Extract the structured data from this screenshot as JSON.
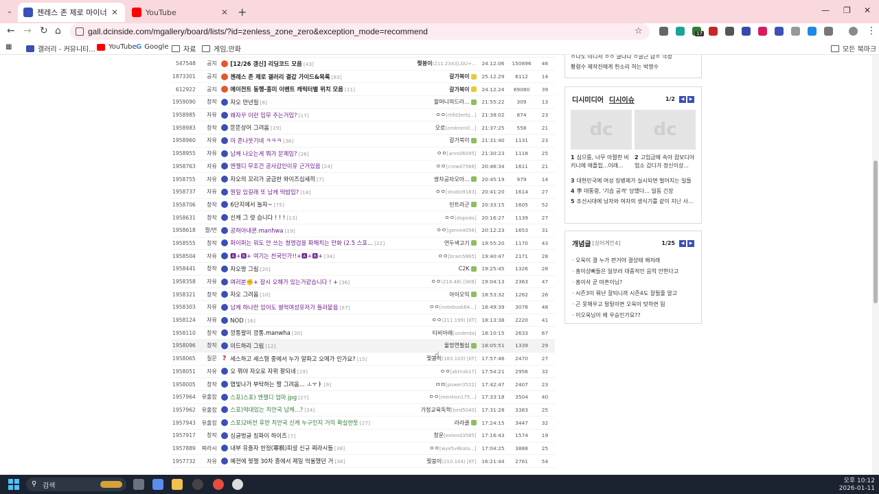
{
  "browser": {
    "tabs": [
      {
        "title": "젠레스 존 제로 마이너 갤러리",
        "active": true
      },
      {
        "title": "YouTube",
        "active": false
      }
    ],
    "url": "gall.dcinside.com/mgallery/board/lists/?id=zenless_zone_zero&exception_mode=recommend",
    "bookmarks": [
      "갤러리 - 커뮤니티...",
      "YouTube",
      "Google",
      "자료",
      "게임,만화"
    ],
    "all_bookmarks": "모든 북마크",
    "ext_badge": "17"
  },
  "notices": [
    {
      "num": "547548",
      "head": "공지",
      "title": "[12/26 갱신] 리딩코드 모음",
      "count": "[43]",
      "writer": "찢붕이",
      "ip": "(211.234)",
      "extra": "[LGU+...",
      "date": "24.12.06",
      "views": "150896",
      "rec": "46"
    },
    {
      "num": "1873301",
      "head": "공지",
      "title": "젠레스 존 제로 갤러리 결갑 가이드&목록",
      "count": "[83]",
      "writer": "갈가북이",
      "ip": "",
      "extra": "",
      "date": "25.12.29",
      "views": "6112",
      "rec": "14"
    },
    {
      "num": "612922",
      "head": "공지",
      "title": "에이전트 동행-흥미 이벤트 캐릭터별 위치 모음",
      "count": "[11]",
      "writer": "갈가북이",
      "ip": "",
      "extra": "",
      "date": "24.12.24",
      "views": "69080",
      "rec": "39"
    }
  ],
  "posts": [
    {
      "num": "1959090",
      "head": "창작",
      "icon": "pic",
      "title": "자오 만년필",
      "count": "[6]",
      "writer": "할머니의드라...",
      "ip": "",
      "date": "21:55:22",
      "views": "309",
      "rec": "13"
    },
    {
      "num": "1958985",
      "head": "자유",
      "icon": "recom",
      "title": "왜자꾸 이런 임무 주는거임?",
      "count": "[17]",
      "purple": true,
      "writer": "ㅇㅇ",
      "ip": "[rtifd3erbj...]",
      "date": "21:38:02",
      "views": "874",
      "rec": "23"
    },
    {
      "num": "1958983",
      "head": "창작",
      "icon": "pic",
      "title": "뚠뚠상어 그려옴",
      "count": "[19]",
      "writer": "오로",
      "ip": "[orokroni0...]",
      "date": "21:37:25",
      "views": "558",
      "rec": "21"
    },
    {
      "num": "1958960",
      "head": "자유",
      "icon": "recom",
      "title": "아 존나웃기네 ㅋㅋㅋ",
      "count": "[38]",
      "purple": true,
      "writer": "갈가북이",
      "ip": "",
      "date": "21:31:40",
      "views": "1131",
      "rec": "23"
    },
    {
      "num": "1958955",
      "head": "자유",
      "icon": "recom",
      "title": "남캐 나오는게 뭐가 문제임?",
      "count": "[26]",
      "purple": true,
      "writer": "ㅇㅇ",
      "ip": "[anroll6095]",
      "date": "21:30:23",
      "views": "1118",
      "rec": "25"
    },
    {
      "num": "1958763",
      "head": "자유",
      "icon": "recom",
      "title": "엔젤디 무조건 공사갑인이유 근거있음",
      "count": "[24]",
      "purple": true,
      "writer": "ㅇㅇ",
      "ip": "[crowd7566]",
      "date": "20:46:34",
      "views": "1611",
      "rec": "21"
    },
    {
      "num": "1958755",
      "head": "자유",
      "icon": "recom",
      "title": "자오의 꼬리가 궁금한 와이즈십새끼",
      "count": "[7]",
      "writer": "쌍차공자오아...",
      "ip": "",
      "date": "20:45:19",
      "views": "979",
      "rec": "14"
    },
    {
      "num": "1958737",
      "head": "자유",
      "icon": "recom",
      "title": "뭔일 있길래 또 남캐 떡밥임?",
      "count": "[18]",
      "purple": true,
      "writer": "ㅇㅇ",
      "ip": "[studio9183]",
      "date": "20:41:20",
      "views": "1614",
      "rec": "27"
    },
    {
      "num": "1958706",
      "head": "창작",
      "icon": "pic",
      "title": "6단지에서 놀자~",
      "count": "[75]",
      "writer": "민트라군",
      "ip": "",
      "date": "20:33:15",
      "views": "1605",
      "rec": "52"
    },
    {
      "num": "1958631",
      "head": "창작",
      "icon": "pic",
      "title": "신캐 그 렷 습니다 ! ! !",
      "count": "[13]",
      "writer": "ㅇㅇ",
      "ip": "[dopodo]",
      "date": "20:16:27",
      "views": "1139",
      "rec": "27"
    },
    {
      "num": "1958618",
      "head": "짤/번",
      "icon": "recom",
      "title": "공허아내쿤.manhwa",
      "count": "[19]",
      "purple": true,
      "writer": "ㅇㅇ",
      "ip": "[genre4056]",
      "date": "20:12:23",
      "views": "1653",
      "rec": "31"
    },
    {
      "num": "1958555",
      "head": "창작",
      "icon": "pic",
      "title": "파이퍼는 워도 안 쓰는 청명검을 파헤치는 만화 (2.5 스포...",
      "count": "[22]",
      "purple": true,
      "writer": "연두색고기",
      "ip": "",
      "date": "19:55:20",
      "views": "1170",
      "rec": "43"
    },
    {
      "num": "1958504",
      "head": "자유",
      "icon": "recom",
      "title": "🅰+🅱+ 여기는 천국인가!!+🅰+🅱+",
      "count": "[34]",
      "purple": true,
      "writer": "ㅇㅇ",
      "ip": "[brain5865]",
      "date": "19:40:47",
      "views": "2171",
      "rec": "28"
    },
    {
      "num": "1958441",
      "head": "창작",
      "icon": "pic",
      "title": "자오짱 그림",
      "count": "[20]",
      "writer": "C2K",
      "ip": "",
      "date": "19:25:45",
      "views": "1326",
      "rec": "28"
    },
    {
      "num": "1958358",
      "head": "자유",
      "icon": "recom",
      "title": "여러분✊+ 잠시 오해가 있는거같습니다 ! +",
      "count": "[36]",
      "purple": true,
      "writer": "ㅇㅇ",
      "ip": "(218.48) [SKB]",
      "date": "19:04:13",
      "views": "2363",
      "rec": "47"
    },
    {
      "num": "1958321",
      "head": "창작",
      "icon": "pic",
      "title": "자오 그려옴",
      "count": "[10]",
      "writer": "아이오익",
      "ip": "",
      "date": "18:53:32",
      "views": "1262",
      "rec": "26"
    },
    {
      "num": "1958303",
      "head": "자유",
      "icon": "recom",
      "title": "남캐 하나만 있어도 썰먹여성유저가 들러붙음",
      "count": "[57]",
      "purple": true,
      "writer": "ㅇㅇ",
      "ip": "[notebook64...]",
      "date": "18:49:39",
      "views": "3078",
      "rec": "48"
    },
    {
      "num": "1958124",
      "head": "자유",
      "icon": "recom",
      "title": "NOD",
      "count": "[16]",
      "writer": "ㅇㅇ",
      "ip": "(211.199) [KT]",
      "date": "18:13:38",
      "views": "2220",
      "rec": "41"
    },
    {
      "num": "1958110",
      "head": "창작",
      "icon": "pic",
      "title": "깡통팔이 깡통.manwha",
      "count": "[30]",
      "writer": "티비아래",
      "ip": "[underda]",
      "date": "18:10:15",
      "views": "2633",
      "rec": "67"
    },
    {
      "num": "1958096",
      "head": "창작",
      "icon": "pic",
      "title": "이드하리 그림",
      "count": "[12]",
      "writer": "울망연필심",
      "ip": "",
      "date": "18:05:51",
      "views": "1339",
      "rec": "29",
      "hover": true
    },
    {
      "num": "1958065",
      "head": "질문",
      "icon": "q",
      "title": "세스하고 세스형 중에서 누가 알파고 오메가 인가요?",
      "count": "[15]",
      "writer": "찢붕이",
      "ip": "(183.103) [KT]",
      "date": "17:57:46",
      "views": "2470",
      "rec": "27"
    },
    {
      "num": "1958051",
      "head": "자유",
      "icon": "recom",
      "title": "오 뭐야 자오로 자위 잘되네",
      "count": "[19]",
      "writer": "ㅇㅇ",
      "ip": "[aktnxk17]",
      "date": "17:54:21",
      "views": "2956",
      "rec": "32"
    },
    {
      "num": "1958005",
      "head": "창작",
      "icon": "pic",
      "title": "엽빛나가 부탁하는 짤 그려옴... ㅗㅜㅑ",
      "count": "[9]",
      "writer": "ㅁㅁ",
      "ip": "[power3522]",
      "date": "17:42:47",
      "views": "2407",
      "rec": "23"
    },
    {
      "num": "1957964",
      "head": "유출잡",
      "icon": "recom",
      "title": "스포)스포) 엔젤디 엄마.jpg",
      "count": "[27]",
      "writer": "ㅇㅇ",
      "ip": "[mention175...]",
      "date": "17:33:18",
      "views": "3504",
      "rec": "40",
      "spoiler": true
    },
    {
      "num": "1957962",
      "head": "유출잡",
      "icon": "recom",
      "title": "스포)떡대있는 치안국 남캐...?",
      "count": "[24]",
      "purple": true,
      "writer": "가정교육독학",
      "ip": "[bird5040]",
      "date": "17:31:28",
      "views": "3383",
      "rec": "25",
      "spoiler": true
    },
    {
      "num": "1957943",
      "head": "유출잡",
      "icon": "recom",
      "title": "스포)2버전 후반 치안국 신캐 누구인지 거의 확실한듯",
      "count": "[27]",
      "writer": "라라클",
      "ip": "",
      "date": "17:24:15",
      "views": "3447",
      "rec": "32",
      "spoiler": true
    },
    {
      "num": "1957917",
      "head": "창작",
      "icon": "pic",
      "title": "싱글벙글 칭파이 하이즈",
      "count": "[7]",
      "writer": "청운",
      "ip": "[extend3585]",
      "date": "17:16:43",
      "views": "1574",
      "rec": "19"
    },
    {
      "num": "1957889",
      "head": "찌라시",
      "icon": "recom",
      "title": "내부 유출자 한정(寒枫)피셜 신규 찌라시들",
      "count": "[38]",
      "writer": "ㅇㅇ",
      "ip": "[wye5v8kala...]",
      "date": "17:04:25",
      "views": "3888",
      "rec": "25"
    },
    {
      "num": "1957732",
      "head": "자유",
      "icon": "recom",
      "title": "예전에 찢젤 30차 중에서 제일 억울했던 거",
      "count": "[38]",
      "writer": "찢붕이",
      "ip": "(210.104) [KT]",
      "date": "16:21:44",
      "views": "2761",
      "rec": "54"
    }
  ],
  "sidebar": {
    "top_lines": [
      "ㅇ나노 미니서 ㅇㅇ 글나나 ㅇ글근 급ㅇ 극성",
      "황령수 제작진에게 헌소리 하는 박명수"
    ],
    "media": {
      "tab1": "디시미디어",
      "tab2": "디시이슈",
      "page": "1/2",
      "captions": [
        {
          "n": "1",
          "text": "심으름, 너무 아찔한 비키니에 애플힙...이래..."
        },
        {
          "n": "2",
          "text": "고임금에 속아 캄보디아 업소 갔다가 정신이상..."
        }
      ],
      "list": [
        {
          "n": "3",
          "text": "대한민국에 여성 징병제가 실시되면 벌어지는 일들"
        },
        {
          "n": "4",
          "text": "李 대통령, '기습 공격' 당했다... 일동 긴장"
        },
        {
          "n": "5",
          "text": "조선시대에 남자와 여자의 생식기를 같이 지닌 사..."
        }
      ]
    },
    "concept": {
      "title": "개념글",
      "subtitle": "[싱어게인4]",
      "page": "1/25",
      "items": [
        "오욱이 결 누가 판거야 결상태 왜저래",
        "흥이상빠들은 일부러 대중적인 음악 안한다고",
        "흥이삭 곧 마흔이님?",
        "시즌3이 뭐냔 잘되니까 시즌4도 잘될줄 알고",
        "곤 못해우고 뒹뒹이면 오욱이 탓하면 됨",
        "이오욱님이 왜 우승인가요??"
      ]
    }
  },
  "taskbar": {
    "search_placeholder": "검색",
    "time": "오후 10:12",
    "date": "2026-01-11"
  },
  "colors": {
    "tabstrip": "#f9d9de",
    "omnibox": "#fdecef",
    "accent_blue": "#3b4fb5",
    "notice_red": "#e4572e",
    "title_purple": "#6b1a8c"
  }
}
